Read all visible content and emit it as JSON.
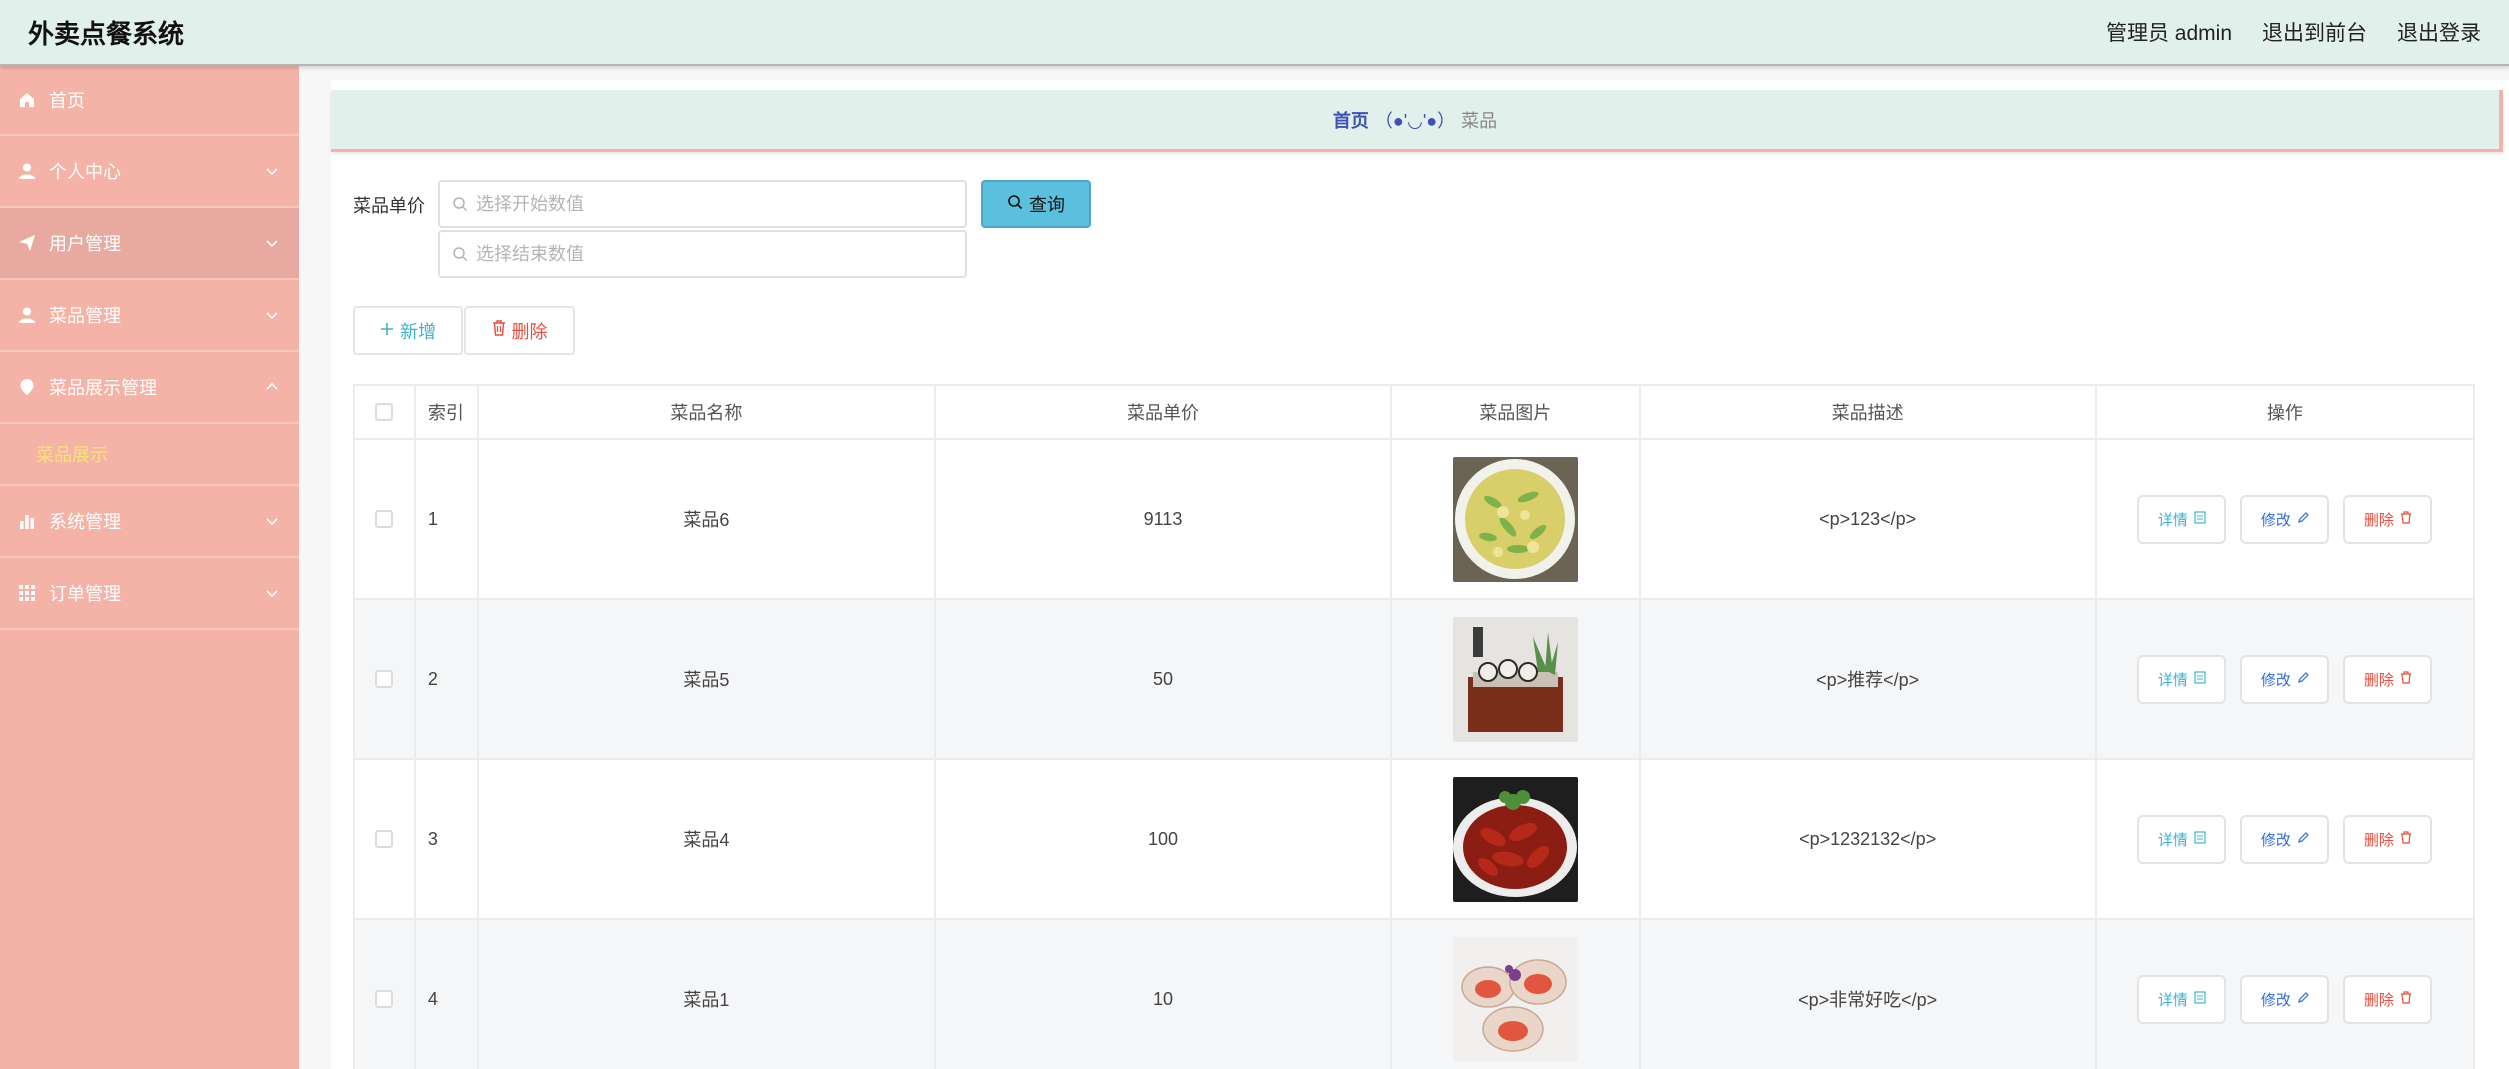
{
  "header": {
    "title": "外卖点餐系统",
    "admin_label": "管理员 admin",
    "back_to_front": "退出到前台",
    "logout": "退出登录"
  },
  "sidebar": {
    "items": [
      {
        "label": "首页",
        "icon": "home-icon"
      },
      {
        "label": "个人中心",
        "icon": "user-icon"
      },
      {
        "label": "用户管理",
        "icon": "send-icon"
      },
      {
        "label": "菜品管理",
        "icon": "user-icon"
      },
      {
        "label": "菜品展示管理",
        "icon": "location-icon"
      },
      {
        "label": "系统管理",
        "icon": "bar-chart-icon"
      },
      {
        "label": "订单管理",
        "icon": "grid-icon"
      }
    ],
    "submenu_active": "菜品展示"
  },
  "breadcrumb": {
    "home": "首页",
    "separator": "（●'◡'●）",
    "current": "菜品"
  },
  "filter": {
    "label": "菜品单价",
    "start_placeholder": "选择开始数值",
    "end_placeholder": "选择结束数值",
    "query_label": "查询"
  },
  "actions": {
    "add_label": "新增",
    "delete_label": "删除"
  },
  "table": {
    "headers": [
      "索引",
      "菜品名称",
      "菜品单价",
      "菜品图片",
      "菜品描述",
      "操作"
    ],
    "rows": [
      {
        "index": "1",
        "name": "菜品6",
        "price": "9113",
        "desc": "<p>123</p>",
        "image": "salad"
      },
      {
        "index": "2",
        "name": "菜品5",
        "price": "50",
        "desc": "<p>推荐</p>",
        "image": "sushi-box"
      },
      {
        "index": "3",
        "name": "菜品4",
        "price": "100",
        "desc": "<p>1232132</p>",
        "image": "crayfish"
      },
      {
        "index": "4",
        "name": "菜品1",
        "price": "10",
        "desc": "<p>非常好吃</p>",
        "image": "shellfish"
      }
    ],
    "op_detail": "详情",
    "op_edit": "修改",
    "op_delete": "删除"
  },
  "colors": {
    "header_bg": "#e1f0eb",
    "sidebar_bg": "#f4b3a6",
    "accent_blue": "#5bc0de",
    "danger": "#e74c3c",
    "submenu_active": "#f6e37a"
  }
}
